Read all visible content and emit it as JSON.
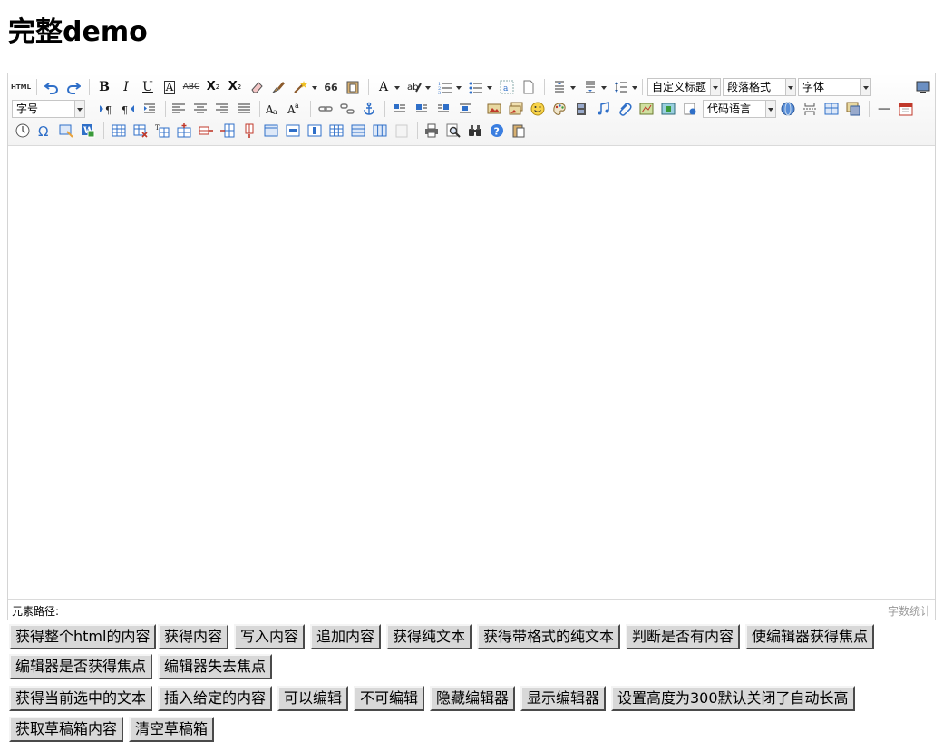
{
  "page": {
    "title": "完整demo"
  },
  "toolbar": {
    "fullscreen_icon": "monitor-icon",
    "combos": {
      "custom_heading": "自定义标题",
      "paragraph_format": "段落格式",
      "font_family": "字体",
      "font_size": "字号",
      "code_language": "代码语言"
    },
    "glyphs": {
      "source": "HTML",
      "bold": "B",
      "italic": "I",
      "underline": "U",
      "font_border": "A",
      "strikethrough": "ABC",
      "superscript": "X",
      "subscript": "X",
      "blockquote": "66",
      "forecolor": "A",
      "horizontal": "—"
    }
  },
  "statusbar": {
    "element_path_label": "元素路径:",
    "word_count_label": "字数统计"
  },
  "buttons": {
    "row1": [
      "获得整个html的内容",
      "获得内容",
      "写入内容",
      "追加内容",
      "获得纯文本",
      "获得带格式的纯文本",
      "判断是否有内容",
      "使编辑器获得焦点"
    ],
    "row2": [
      "编辑器是否获得焦点",
      "编辑器失去焦点"
    ],
    "row3": [
      "获得当前选中的文本",
      "插入给定的内容",
      "可以编辑",
      "不可编辑",
      "隐藏编辑器",
      "显示编辑器",
      "设置高度为300默认关闭了自动长高"
    ],
    "row4": [
      "获取草稿箱内容",
      "清空草稿箱"
    ]
  },
  "colors": {
    "accent_blue": "#2f6fc8",
    "toolbar_bg": "#f3f3f3",
    "button_bg": "#d8d8d8"
  }
}
